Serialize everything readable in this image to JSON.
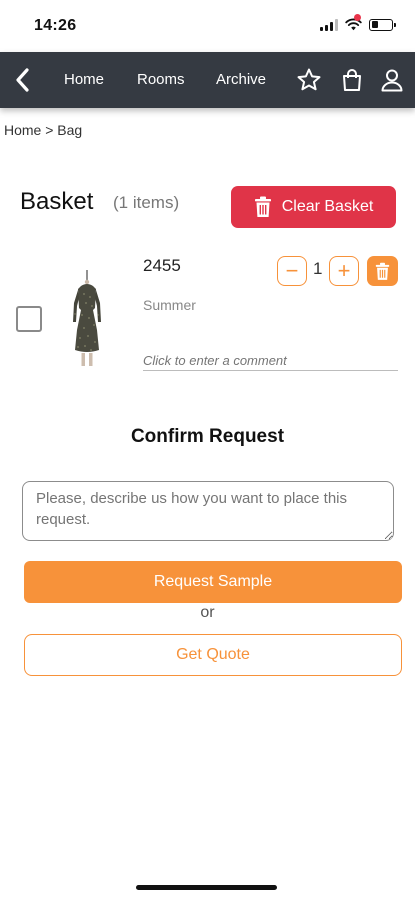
{
  "colors": {
    "nav_bg": "#353a42",
    "danger": "#e03448",
    "accent": "#f7923a",
    "notification_dot": "#e8334a"
  },
  "status_bar": {
    "time": "14:26",
    "icons": [
      "signal-icon",
      "wifi-icon",
      "battery-icon"
    ],
    "battery_level": 0.35
  },
  "nav": {
    "back_icon": "chevron-left-icon",
    "links": [
      "Home",
      "Rooms",
      "Archive"
    ],
    "icons": [
      "star-icon",
      "shopping-bag-icon",
      "user-icon"
    ]
  },
  "breadcrumb": "Home > Bag",
  "basket": {
    "title": "Basket",
    "count": "(1 items)",
    "clear_label": "Clear Basket",
    "clear_icon": "trash-icon"
  },
  "items": [
    {
      "code": "2455",
      "season": "Summer",
      "quantity": "1",
      "minus": "−",
      "plus": "+",
      "comment_placeholder": "Click to enter a comment",
      "checked": false,
      "image_icon": "dress-image"
    }
  ],
  "confirm": {
    "title": "Confirm Request",
    "description_placeholder": "Please, describe us how you want to place this request.",
    "request_label": "Request Sample",
    "or_text": "or",
    "quote_label": "Get Quote"
  }
}
